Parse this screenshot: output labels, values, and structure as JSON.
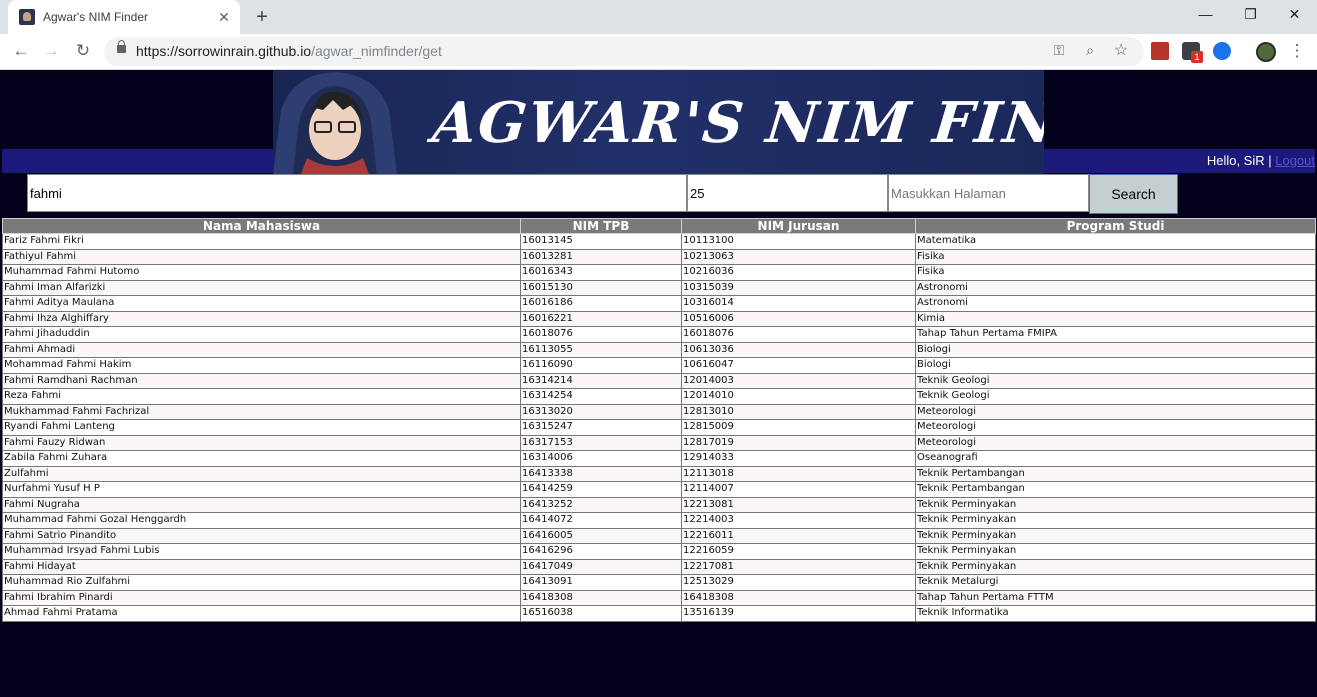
{
  "browser": {
    "tab_title": "Agwar's NIM Finder",
    "url_host": "https://sorrowinrain.github.io",
    "url_path": "/agwar_nimfinder/get",
    "ext_badge": "1"
  },
  "header": {
    "banner_title": "AGWAR'S NIM FINDER",
    "greeting": "Hello, SiR | ",
    "logout_label": "Logout"
  },
  "search": {
    "query": "fahmi",
    "limit": "25",
    "page_placeholder": "Masukkan Halaman",
    "button_label": "Search"
  },
  "table": {
    "headers": [
      "Nama Mahasiswa",
      "NIM TPB",
      "NIM Jurusan",
      "Program Studi"
    ],
    "rows": [
      [
        "Fariz Fahmi Fikri",
        "16013145",
        "10113100",
        "Matematika"
      ],
      [
        "Fathiyul Fahmi",
        "16013281",
        "10213063",
        "Fisika"
      ],
      [
        "Muhammad Fahmi Hutomo",
        "16016343",
        "10216036",
        "Fisika"
      ],
      [
        "Fahmi Iman Alfarizki",
        "16015130",
        "10315039",
        "Astronomi"
      ],
      [
        "Fahmi Aditya Maulana",
        "16016186",
        "10316014",
        "Astronomi"
      ],
      [
        "Fahmi Ihza Alghiffary",
        "16016221",
        "10516006",
        "Kimia"
      ],
      [
        "Fahmi Jihaduddin",
        "16018076",
        "16018076",
        "Tahap Tahun Pertama FMIPA"
      ],
      [
        "Fahmi Ahmadi",
        "16113055",
        "10613036",
        "Biologi"
      ],
      [
        "Mohammad Fahmi Hakim",
        "16116090",
        "10616047",
        "Biologi"
      ],
      [
        "Fahmi Ramdhani Rachman",
        "16314214",
        "12014003",
        "Teknik Geologi"
      ],
      [
        "Reza Fahmi",
        "16314254",
        "12014010",
        "Teknik Geologi"
      ],
      [
        "Mukhammad Fahmi Fachrizal",
        "16313020",
        "12813010",
        "Meteorologi"
      ],
      [
        "Ryandi Fahmi Lanteng",
        "16315247",
        "12815009",
        "Meteorologi"
      ],
      [
        "Fahmi Fauzy Ridwan",
        "16317153",
        "12817019",
        "Meteorologi"
      ],
      [
        "Zabila Fahmi Zuhara",
        "16314006",
        "12914033",
        "Oseanografi"
      ],
      [
        "Zulfahmi",
        "16413338",
        "12113018",
        "Teknik Pertambangan"
      ],
      [
        "Nurfahmi Yusuf H P",
        "16414259",
        "12114007",
        "Teknik Pertambangan"
      ],
      [
        "Fahmi Nugraha",
        "16413252",
        "12213081",
        "Teknik Perminyakan"
      ],
      [
        "Muhammad Fahmi Gozal Henggardh",
        "16414072",
        "12214003",
        "Teknik Perminyakan"
      ],
      [
        "Fahmi Satrio Pinandito",
        "16416005",
        "12216011",
        "Teknik Perminyakan"
      ],
      [
        "Muhammad Irsyad Fahmi Lubis",
        "16416296",
        "12216059",
        "Teknik Perminyakan"
      ],
      [
        "Fahmi Hidayat",
        "16417049",
        "12217081",
        "Teknik Perminyakan"
      ],
      [
        "Muhammad Rio Zulfahmi",
        "16413091",
        "12513029",
        "Teknik Metalurgi"
      ],
      [
        "Fahmi Ibrahim Pinardi",
        "16418308",
        "16418308",
        "Tahap Tahun Pertama FTTM"
      ],
      [
        "Ahmad Fahmi Pratama",
        "16516038",
        "13516139",
        "Teknik Informatika"
      ]
    ]
  },
  "colors": {
    "page_bg": "#03021a",
    "stripe": "#1b1a7a",
    "table_header": "#7a7a7a"
  }
}
